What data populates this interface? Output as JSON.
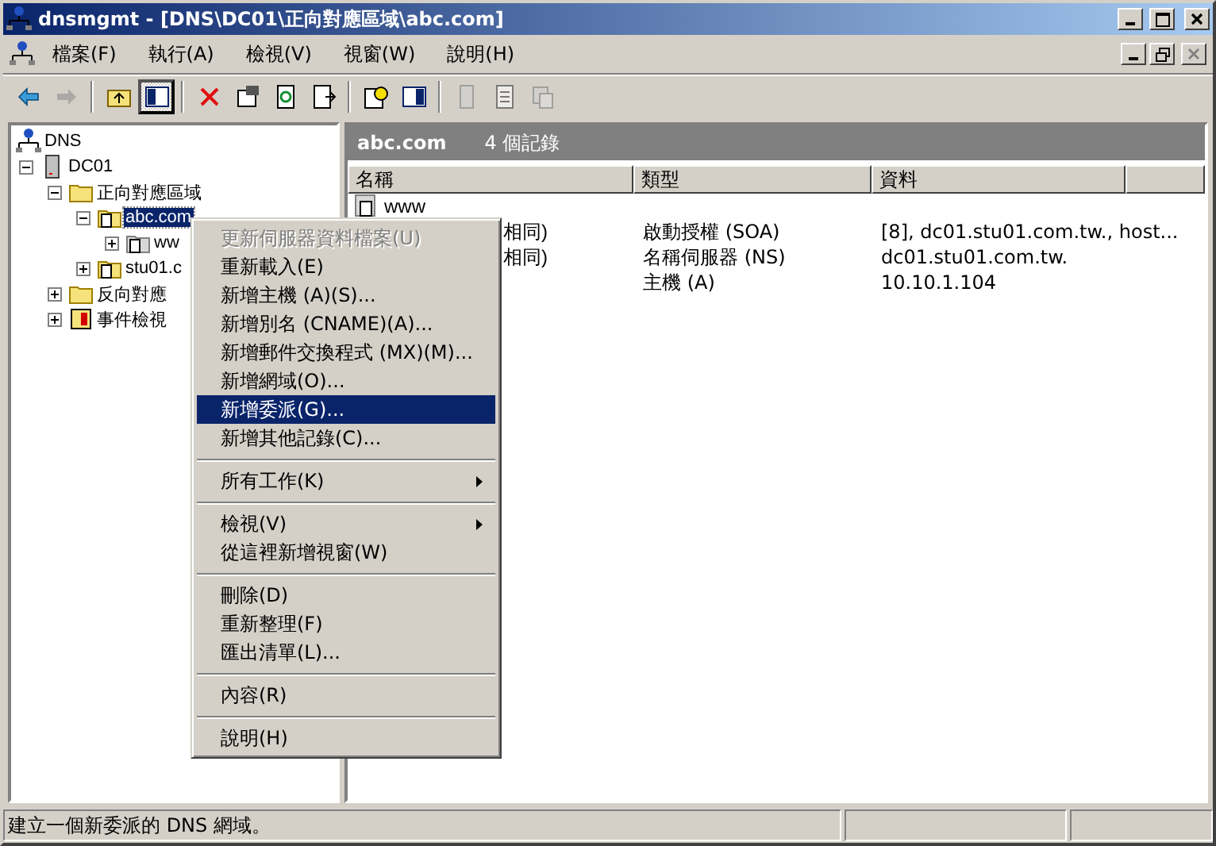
{
  "window": {
    "title": "dnsmgmt - [DNS\\DC01\\正向對應區域\\abc.com]"
  },
  "menu_bar": [
    {
      "label": "檔案(F)"
    },
    {
      "label": "執行(A)"
    },
    {
      "label": "檢視(V)"
    },
    {
      "label": "視窗(W)"
    },
    {
      "label": "說明(H)"
    }
  ],
  "toolbar": [
    {
      "kind": "button",
      "pressed": false,
      "disabled": false
    },
    {
      "kind": "button",
      "pressed": false,
      "disabled": true
    },
    {
      "kind": "separator"
    },
    {
      "kind": "button",
      "pressed": false,
      "disabled": false
    },
    {
      "kind": "button",
      "pressed": true,
      "disabled": false
    },
    {
      "kind": "separator"
    },
    {
      "kind": "button",
      "pressed": false,
      "disabled": false
    },
    {
      "kind": "button",
      "pressed": false,
      "disabled": false
    },
    {
      "kind": "button",
      "pressed": false,
      "disabled": false
    },
    {
      "kind": "button",
      "pressed": false,
      "disabled": false
    },
    {
      "kind": "separator"
    },
    {
      "kind": "button",
      "pressed": false,
      "disabled": false
    },
    {
      "kind": "button",
      "pressed": false,
      "disabled": false
    },
    {
      "kind": "separator"
    },
    {
      "kind": "button",
      "pressed": false,
      "disabled": true
    },
    {
      "kind": "button",
      "pressed": false,
      "disabled": true
    },
    {
      "kind": "button",
      "pressed": false,
      "disabled": true
    }
  ],
  "tree": [
    {
      "label": "DNS",
      "kind": "root",
      "selected": false,
      "children": [
        {
          "label": "DC01",
          "kind": "server",
          "expanded": true,
          "selected": false,
          "children": [
            {
              "label": "正向對應區域",
              "kind": "folder",
              "expanded": true,
              "selected": false,
              "children": [
                {
                  "label": "abc.com",
                  "kind": "zone",
                  "expanded": true,
                  "selected": true,
                  "children": [
                    {
                      "label": "ww",
                      "kind": "subzone",
                      "expanded": false,
                      "selected": false
                    }
                  ]
                },
                {
                  "label": "stu01.c",
                  "kind": "zone",
                  "expanded": false,
                  "selected": false
                }
              ]
            },
            {
              "label": "反向對應",
              "kind": "folder",
              "expanded": false,
              "selected": false
            },
            {
              "label": "事件檢視",
              "kind": "log",
              "expanded": false,
              "selected": false
            }
          ]
        }
      ]
    }
  ],
  "header": {
    "title": "abc.com",
    "count": "4 個記錄"
  },
  "table": {
    "columns": [
      "名稱",
      "類型",
      "資料"
    ],
    "rows": [
      {
        "name": "www",
        "icon": true,
        "type": "",
        "data": ""
      },
      {
        "name": "相同)",
        "icon": false,
        "type": "啟動授權 (SOA)",
        "data": "[8], dc01.stu01.com.tw., host..."
      },
      {
        "name": "相同)",
        "icon": false,
        "type": "名稱伺服器 (NS)",
        "data": "dc01.stu01.com.tw."
      },
      {
        "name": "",
        "type": "主機 (A)",
        "data": "10.10.1.104"
      }
    ]
  },
  "context_menu": [
    {
      "kind": "item",
      "label": "更新伺服器資料檔案(U)",
      "disabled": true,
      "selected": false,
      "submenu": false
    },
    {
      "kind": "item",
      "label": "重新載入(E)",
      "disabled": false,
      "selected": false,
      "submenu": false
    },
    {
      "kind": "item",
      "label": "新增主機 (A)(S)...",
      "disabled": false,
      "selected": false,
      "submenu": false
    },
    {
      "kind": "item",
      "label": "新增別名 (CNAME)(A)...",
      "disabled": false,
      "selected": false,
      "submenu": false
    },
    {
      "kind": "item",
      "label": "新增郵件交換程式 (MX)(M)...",
      "disabled": false,
      "selected": false,
      "submenu": false
    },
    {
      "kind": "item",
      "label": "新增網域(O)...",
      "disabled": false,
      "selected": false,
      "submenu": false
    },
    {
      "kind": "item",
      "label": "新增委派(G)...",
      "disabled": false,
      "selected": true,
      "submenu": false
    },
    {
      "kind": "item",
      "label": "新增其他記錄(C)...",
      "disabled": false,
      "selected": false,
      "submenu": false
    },
    {
      "kind": "separator"
    },
    {
      "kind": "item",
      "label": "所有工作(K)",
      "disabled": false,
      "selected": false,
      "submenu": true
    },
    {
      "kind": "separator"
    },
    {
      "kind": "item",
      "label": "檢視(V)",
      "disabled": false,
      "selected": false,
      "submenu": true
    },
    {
      "kind": "item",
      "label": "從這裡新增視窗(W)",
      "disabled": false,
      "selected": false,
      "submenu": false
    },
    {
      "kind": "separator"
    },
    {
      "kind": "item",
      "label": "刪除(D)",
      "disabled": false,
      "selected": false,
      "submenu": false
    },
    {
      "kind": "item",
      "label": "重新整理(F)",
      "disabled": false,
      "selected": false,
      "submenu": false
    },
    {
      "kind": "item",
      "label": "匯出清單(L)...",
      "disabled": false,
      "selected": false,
      "submenu": false
    },
    {
      "kind": "separator"
    },
    {
      "kind": "item",
      "label": "內容(R)",
      "disabled": false,
      "selected": false,
      "submenu": false
    },
    {
      "kind": "separator"
    },
    {
      "kind": "item",
      "label": "說明(H)",
      "disabled": false,
      "selected": false,
      "submenu": false
    }
  ],
  "status_bar": {
    "text": "建立一個新委派的 DNS 網域。"
  }
}
